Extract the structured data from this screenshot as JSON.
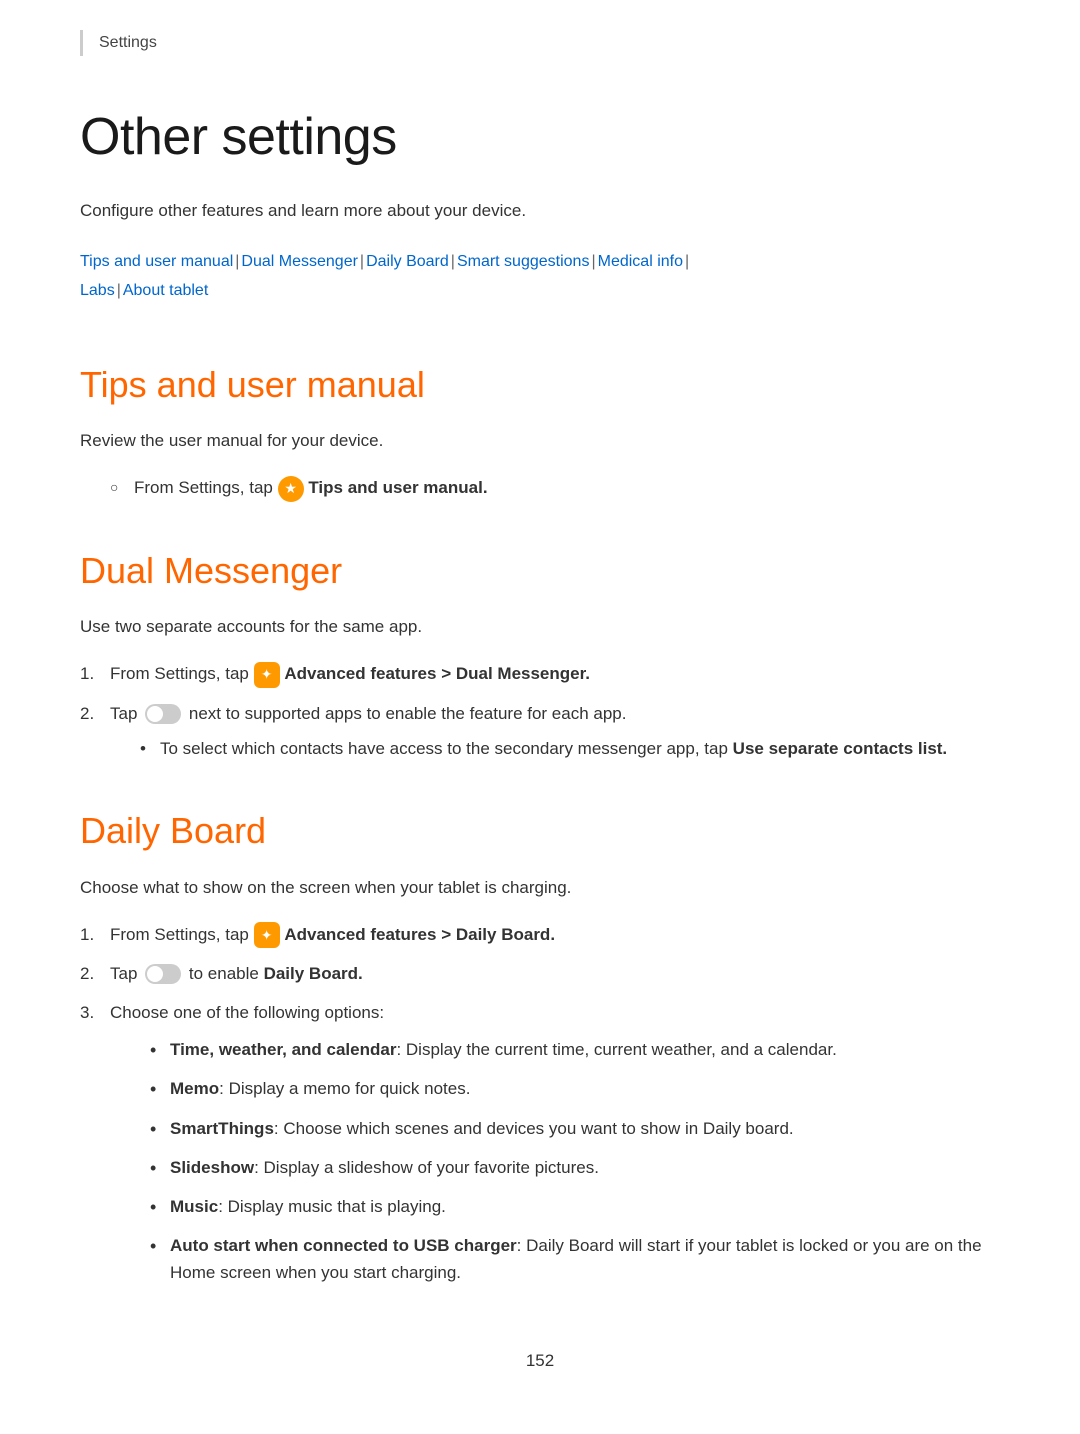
{
  "breadcrumb": {
    "label": "Settings"
  },
  "page": {
    "title": "Other settings",
    "description": "Configure other features and learn more about your device."
  },
  "nav_links": {
    "items": [
      "Tips and user manual",
      "Dual Messenger",
      "Daily Board",
      "Smart suggestions",
      "Medical info",
      "Labs",
      "About tablet"
    ]
  },
  "sections": {
    "tips": {
      "title": "Tips and user manual",
      "description": "Review the user manual for your device.",
      "step1": "From Settings, tap",
      "step1_bold": "Tips and user manual."
    },
    "dual_messenger": {
      "title": "Dual Messenger",
      "description": "Use two separate accounts for the same app.",
      "step1_prefix": "From Settings, tap",
      "step1_bold": "Advanced features > Dual Messenger.",
      "step2_prefix": "Tap",
      "step2_suffix": "next to supported apps to enable the feature for each app.",
      "sub_bullet": "To select which contacts have access to the secondary messenger app, tap",
      "sub_bullet_bold": "Use separate contacts list."
    },
    "daily_board": {
      "title": "Daily Board",
      "description": "Choose what to show on the screen when your tablet is charging.",
      "step1_prefix": "From Settings, tap",
      "step1_bold": "Advanced features > Daily Board.",
      "step2_prefix": "Tap",
      "step2_suffix": "to enable",
      "step2_bold": "Daily Board.",
      "step3": "Choose one of the following options:",
      "options": [
        {
          "bold": "Time, weather, and calendar",
          "text": ": Display the current time, current weather, and a calendar."
        },
        {
          "bold": "Memo",
          "text": ": Display a memo for quick notes."
        },
        {
          "bold": "SmartThings",
          "text": ": Choose which scenes and devices you want to show in Daily board."
        },
        {
          "bold": "Slideshow",
          "text": ": Display a slideshow of your favorite pictures."
        },
        {
          "bold": "Music",
          "text": ": Display music that is playing."
        },
        {
          "bold": "Auto start when connected to USB charger",
          "text": ": Daily Board will start if your tablet is locked or you are on the Home screen when you start charging."
        }
      ]
    }
  },
  "footer": {
    "page_number": "152"
  },
  "icons": {
    "tips_icon": "★",
    "advanced_icon": "✦",
    "toggle_icon": "toggle"
  },
  "colors": {
    "accent": "#ff6600",
    "link": "#0066cc",
    "text": "#333333",
    "heading": "#1a1a1a"
  }
}
